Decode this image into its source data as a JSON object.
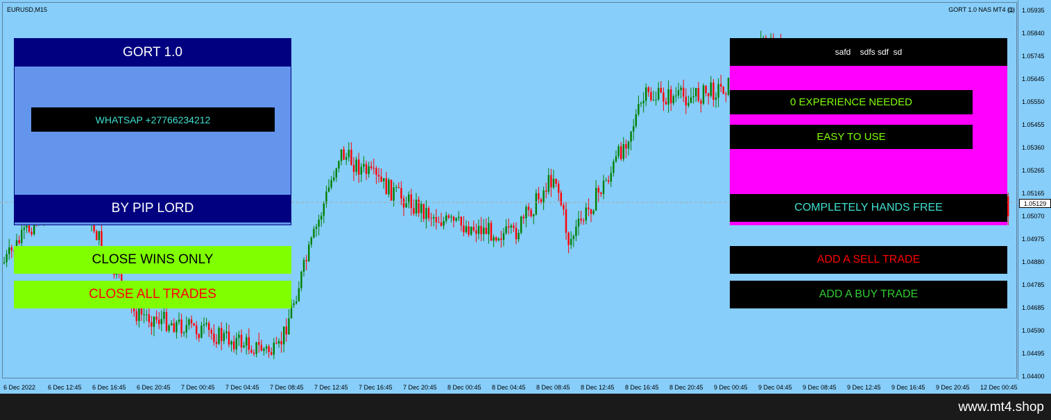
{
  "chart": {
    "symbol": "EURUSD,M15",
    "expert": "GORT 1.0 NAS MT4 (1)",
    "price_labels": [
      "1.05935",
      "1.05840",
      "1.05745",
      "1.05645",
      "1.05550",
      "1.05455",
      "1.05360",
      "1.05265",
      "1.05165",
      "1.05070",
      "1.04975",
      "1.04880",
      "1.04785",
      "1.04685",
      "1.04590",
      "1.04495",
      "1.04400"
    ],
    "current_price": "1.05129",
    "time_labels": [
      "6 Dec 2022",
      "6 Dec 12:45",
      "6 Dec 16:45",
      "6 Dec 20:45",
      "7 Dec 00:45",
      "7 Dec 04:45",
      "7 Dec 08:45",
      "7 Dec 12:45",
      "7 Dec 16:45",
      "7 Dec 20:45",
      "8 Dec 00:45",
      "8 Dec 04:45",
      "8 Dec 08:45",
      "8 Dec 12:45",
      "8 Dec 16:45",
      "8 Dec 20:45",
      "9 Dec 00:45",
      "9 Dec 04:45",
      "9 Dec 08:45",
      "9 Dec 12:45",
      "9 Dec 16:45",
      "9 Dec 20:45",
      "12 Dec 00:45"
    ],
    "colors": {
      "background": "#87cefa",
      "bull": "#008000",
      "bear": "#ff0000"
    }
  },
  "left_panel": {
    "title": "GORT 1.0",
    "whatsapp": "WHATSAP +27766234212",
    "footer": "BY PIP LORD",
    "close_wins": "CLOSE WINS ONLY",
    "close_all": "CLOSE ALL TRADES"
  },
  "right_panel": {
    "header": "safd    sdfs sdf  sd",
    "experience": "0 EXPERIENCE NEEDED",
    "easy": "EASY TO USE",
    "hands_free": "COMPLETELY HANDS FREE",
    "sell": "ADD A SELL TRADE",
    "buy": "ADD A BUY TRADE"
  },
  "footer": {
    "site": "www.mt4.shop"
  }
}
